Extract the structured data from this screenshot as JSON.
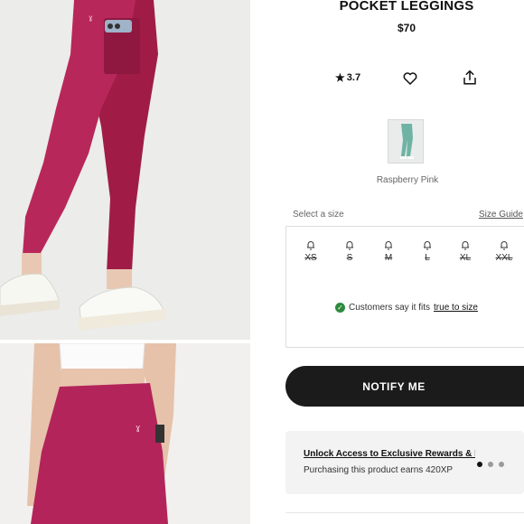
{
  "product": {
    "title": "POCKET LEGGINGS",
    "price": "$70"
  },
  "actions": {
    "rating": "3.7",
    "rating_icon": "star-icon",
    "wishlist_icon": "heart-icon",
    "share_icon": "share-icon"
  },
  "color": {
    "name": "Raspberry Pink",
    "accent": "#b02050"
  },
  "sizes": {
    "label": "Select a size",
    "guide": "Size Guide",
    "options": [
      "XS",
      "S",
      "M",
      "L",
      "XL",
      "XXL"
    ],
    "icon": "bell-icon"
  },
  "fit": {
    "text": "Customers say it fits",
    "link": "true to size"
  },
  "cta": {
    "label": "NOTIFY ME"
  },
  "promo": {
    "title": "Unlock Access to Exclusive Rewards & B...",
    "subtitle": "Purchasing this product earns 420XP"
  }
}
